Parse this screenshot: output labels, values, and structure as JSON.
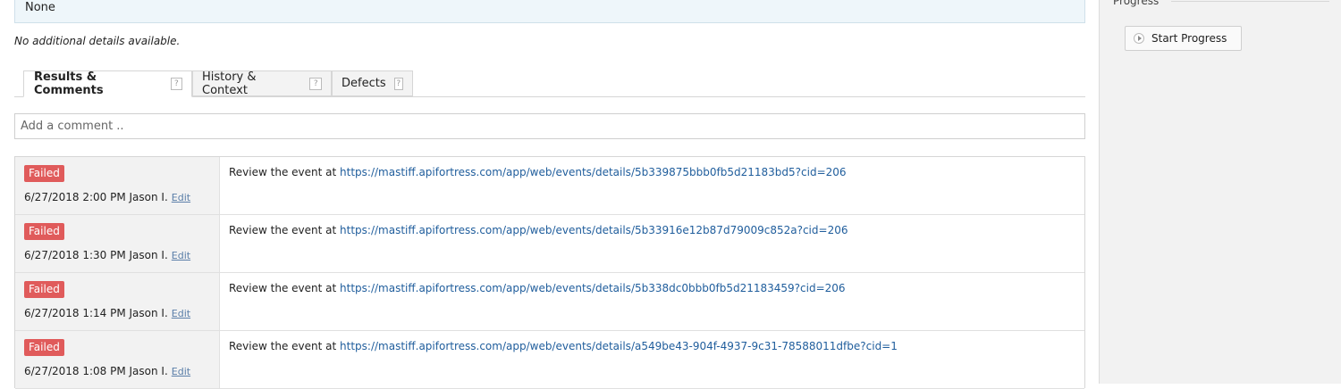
{
  "info": {
    "value": "None"
  },
  "details_note": "No additional details available.",
  "tabs": [
    {
      "label": "Results & Comments",
      "help": "?"
    },
    {
      "label": "History & Context",
      "help": "?"
    },
    {
      "label": "Defects",
      "help": "?"
    }
  ],
  "comment": {
    "placeholder": "Add a comment .."
  },
  "results": [
    {
      "status": "Failed",
      "meta": "6/27/2018 2:00 PM Jason I.",
      "edit": "Edit",
      "prefix": "Review the event at ",
      "link": "https://mastiff.apifortress.com/app/web/events/details/5b339875bbb0fb5d21183bd5?cid=206"
    },
    {
      "status": "Failed",
      "meta": "6/27/2018 1:30 PM Jason I.",
      "edit": "Edit",
      "prefix": "Review the event at ",
      "link": "https://mastiff.apifortress.com/app/web/events/details/5b33916e12b87d79009c852a?cid=206"
    },
    {
      "status": "Failed",
      "meta": "6/27/2018 1:14 PM Jason I.",
      "edit": "Edit",
      "prefix": "Review the event at ",
      "link": "https://mastiff.apifortress.com/app/web/events/details/5b338dc0bbb0fb5d21183459?cid=206"
    },
    {
      "status": "Failed",
      "meta": "6/27/2018 1:08 PM Jason I.",
      "edit": "Edit",
      "prefix": "Review the event at ",
      "link": "https://mastiff.apifortress.com/app/web/events/details/a549be43-904f-4937-9c31-78588011dfbe?cid=1"
    }
  ],
  "sidebar": {
    "progress_label": "Progress",
    "start_button": "Start Progress",
    "start_icon": "play-circle-icon"
  },
  "colors": {
    "failed": "#e05b5b",
    "link": "#1f5d9c",
    "sidebar_bg": "#f2f2f2"
  }
}
